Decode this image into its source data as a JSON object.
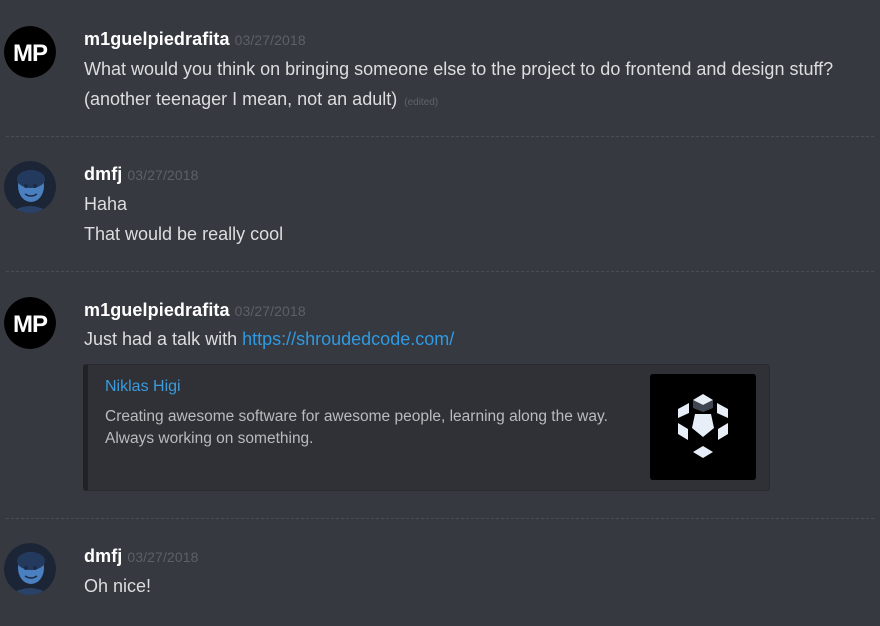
{
  "messages": [
    {
      "author": "m1guelpiedrafita",
      "timestamp": "03/27/2018",
      "avatar": "mp-logo-avatar",
      "lines": [
        "What would you think on bringing someone else to the project to do frontend and design stuff?",
        "(another teenager I mean, not an adult)"
      ],
      "edited_label": "(edited)"
    },
    {
      "author": "dmfj",
      "timestamp": "03/27/2018",
      "avatar": "user-photo-avatar",
      "lines": [
        "Haha",
        "That would be really cool"
      ]
    },
    {
      "author": "m1guelpiedrafita",
      "timestamp": "03/27/2018",
      "avatar": "mp-logo-avatar",
      "text_prefix": "Just had a talk with ",
      "link": "https://shroudedcode.com/",
      "embed": {
        "title": "Niklas Higi",
        "description": "Creating awesome software for awesome people, learning along the way. Always working on something.",
        "thumbnail": "cube-logo-icon"
      }
    },
    {
      "author": "dmfj",
      "timestamp": "03/27/2018",
      "avatar": "user-photo-avatar",
      "lines": [
        "Oh nice!"
      ]
    }
  ],
  "avatar_text": "MP",
  "colors": {
    "background": "#36393f",
    "author": "#ffffff",
    "timestamp": "#5d6066",
    "link": "#2e9ae3",
    "embed_title": "#3b9bdc",
    "embed_bg": "#2f3136"
  }
}
